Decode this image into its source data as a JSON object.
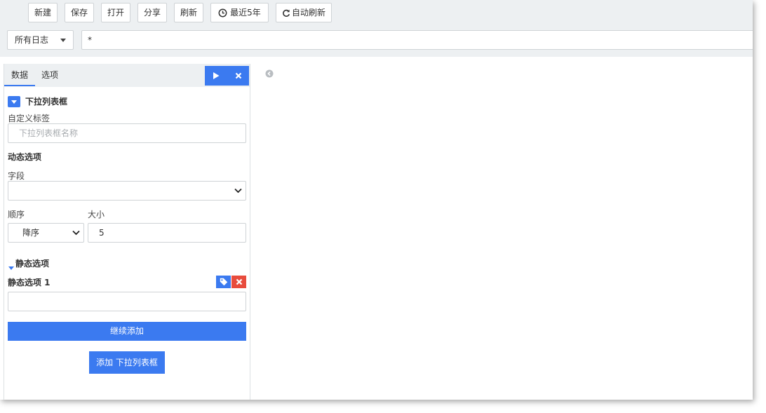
{
  "toolbar": {
    "new_label": "新建",
    "save_label": "保存",
    "open_label": "打开",
    "share_label": "分享",
    "refresh_label": "刷新",
    "time_range_label": "最近5年",
    "auto_refresh_label": "自动刷新"
  },
  "search": {
    "log_source": "所有日志",
    "query_value": "*"
  },
  "panel": {
    "tabs": [
      {
        "label": "数据",
        "active": true
      },
      {
        "label": "选项",
        "active": false
      }
    ],
    "section_title": "下拉列表框",
    "custom_label": {
      "label": "自定义标签",
      "placeholder": "下拉列表框名称"
    },
    "dynamic_options": {
      "title": "动态选项",
      "field_label": "字段",
      "field_value": "",
      "order_label": "顺序",
      "order_value": "降序",
      "size_label": "大小",
      "size_value": "5"
    },
    "static_options": {
      "title": "静态选项",
      "item_label": "静态选项 1",
      "item_value": ""
    },
    "continue_add_label": "继续添加",
    "add_button_label": "添加 下拉列表框"
  },
  "colors": {
    "accent": "#3b7af0",
    "danger": "#e84c3d",
    "toolbar_bg": "#edf0f2"
  },
  "icons": [
    "clock-icon",
    "refresh-icon",
    "caret-down-icon",
    "play-icon",
    "close-icon",
    "chevron-down-icon",
    "tag-icon",
    "chevron-left-circle-icon"
  ]
}
